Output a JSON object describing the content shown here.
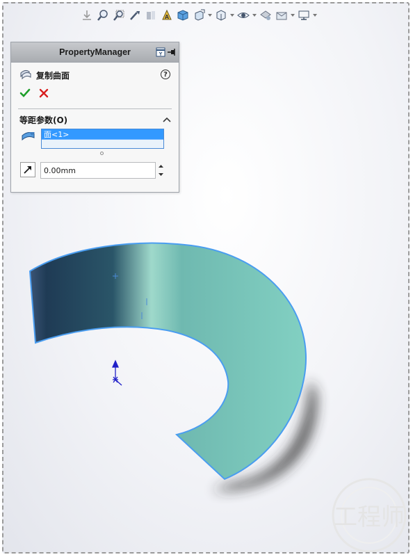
{
  "toolbar": {
    "icons": [
      "view-orientation-icon",
      "zoom-to-fit-icon",
      "zoom-to-area-icon",
      "previous-view-icon",
      "section-view-icon",
      "dynamic-annotation-icon",
      "view-orientation-cube-icon",
      "display-style-icon",
      "hide-show-items-icon",
      "edit-appearance-icon",
      "apply-scene-icon",
      "view-settings-icon"
    ]
  },
  "property_manager": {
    "title": "PropertyManager",
    "feature_name": "复制曲面",
    "help_label": "?",
    "group_title": "等距参数(O)",
    "selection_items": [
      "面<1>"
    ],
    "distance_value": "0.00mm"
  },
  "colors": {
    "accent": "#3399ff",
    "ok_green": "#1e9e2a",
    "cancel_red": "#d81e1e",
    "surface_teal": "#7ecfc0",
    "surface_dark": "#1c3a52"
  }
}
